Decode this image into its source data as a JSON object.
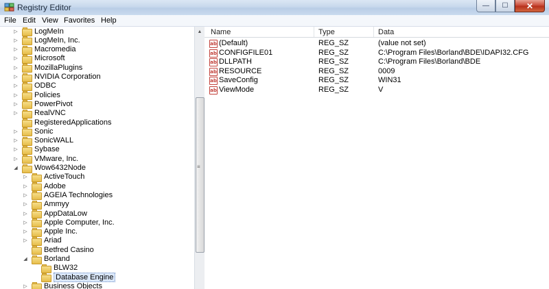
{
  "window": {
    "title": "Registry Editor"
  },
  "menu": [
    "File",
    "Edit",
    "View",
    "Favorites",
    "Help"
  ],
  "tree": {
    "items": [
      {
        "label": "LogMeIn",
        "expander": "▷"
      },
      {
        "label": "LogMeIn, Inc.",
        "expander": "▷"
      },
      {
        "label": "Macromedia",
        "expander": "▷"
      },
      {
        "label": "Microsoft",
        "expander": "▷"
      },
      {
        "label": "MozillaPlugins",
        "expander": "▷"
      },
      {
        "label": "NVIDIA Corporation",
        "expander": "▷"
      },
      {
        "label": "ODBC",
        "expander": "▷"
      },
      {
        "label": "Policies",
        "expander": "▷"
      },
      {
        "label": "PowerPivot",
        "expander": "▷"
      },
      {
        "label": "RealVNC",
        "expander": "▷"
      },
      {
        "label": "RegisteredApplications",
        "expander": ""
      },
      {
        "label": "Sonic",
        "expander": "▷"
      },
      {
        "label": "SonicWALL",
        "expander": "▷"
      },
      {
        "label": "Sybase",
        "expander": "▷"
      },
      {
        "label": "VMware, Inc.",
        "expander": "▷"
      },
      {
        "label": "Wow6432Node",
        "expander": "◢"
      },
      {
        "label": "ActiveTouch",
        "expander": "▷"
      },
      {
        "label": "Adobe",
        "expander": "▷"
      },
      {
        "label": "AGEIA Technologies",
        "expander": "▷"
      },
      {
        "label": "Ammyy",
        "expander": "▷"
      },
      {
        "label": "AppDataLow",
        "expander": "▷"
      },
      {
        "label": "Apple Computer, Inc.",
        "expander": "▷"
      },
      {
        "label": "Apple Inc.",
        "expander": "▷"
      },
      {
        "label": "Ariad",
        "expander": "▷"
      },
      {
        "label": "Betfred Casino",
        "expander": ""
      },
      {
        "label": "Borland",
        "expander": "◢"
      },
      {
        "label": "BLW32",
        "expander": ""
      },
      {
        "label": "Database Engine",
        "expander": ""
      },
      {
        "label": "Business Objects",
        "expander": "▷"
      }
    ]
  },
  "values": {
    "headers": {
      "name": "Name",
      "type": "Type",
      "data": "Data"
    },
    "rows": [
      {
        "name": "(Default)",
        "type": "REG_SZ",
        "data": "(value not set)",
        "icon": "ab"
      },
      {
        "name": "CONFIGFILE01",
        "type": "REG_SZ",
        "data": "C:\\Program Files\\Borland\\BDE\\IDAPI32.CFG",
        "icon": "ab"
      },
      {
        "name": "DLLPATH",
        "type": "REG_SZ",
        "data": "C:\\Program Files\\Borland\\BDE",
        "icon": "ab"
      },
      {
        "name": "RESOURCE",
        "type": "REG_SZ",
        "data": "0009",
        "icon": "ab"
      },
      {
        "name": "SaveConfig",
        "type": "REG_SZ",
        "data": "WIN31",
        "icon": "ab"
      },
      {
        "name": "ViewMode",
        "type": "REG_SZ",
        "data": "V",
        "icon": "ab"
      }
    ]
  },
  "scrollbar": {
    "grip": "≡"
  },
  "caption": {
    "minimize": "—",
    "maximize": "☐",
    "close": "✕"
  }
}
